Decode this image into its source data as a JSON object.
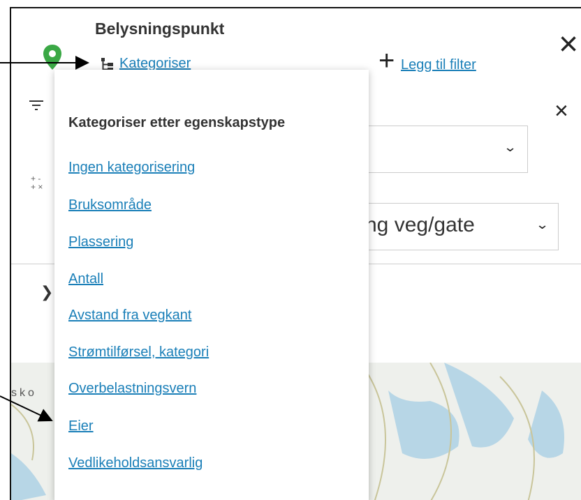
{
  "header": {
    "title": "Belysningspunkt",
    "kategoriser_label": "Kategoriser",
    "legg_til_filter_label": "Legg til filter"
  },
  "filters": {
    "select1_value": "",
    "select2_value": "ng veg/gate"
  },
  "dropdown": {
    "heading": "Kategoriser etter egenskapstype",
    "items": [
      "Ingen kategorisering",
      "Bruksområde",
      "Plassering",
      "Antall",
      "Avstand fra vegkant",
      "Strømtilførsel, kategori",
      "Overbelastningsvern",
      "Eier",
      "Vedlikeholdsansvarlig"
    ]
  },
  "map": {
    "partial_label": "sko"
  },
  "colors": {
    "link": "#1a7fb8",
    "pin": "#3aa845"
  },
  "icons": {
    "pin": "map-pin-icon",
    "tree": "hierarchy-icon",
    "plus": "plus-icon",
    "close": "close-icon",
    "filter": "filter-icon",
    "chevron_down": "chevron-down-icon",
    "chevron_right": "chevron-right-icon"
  }
}
